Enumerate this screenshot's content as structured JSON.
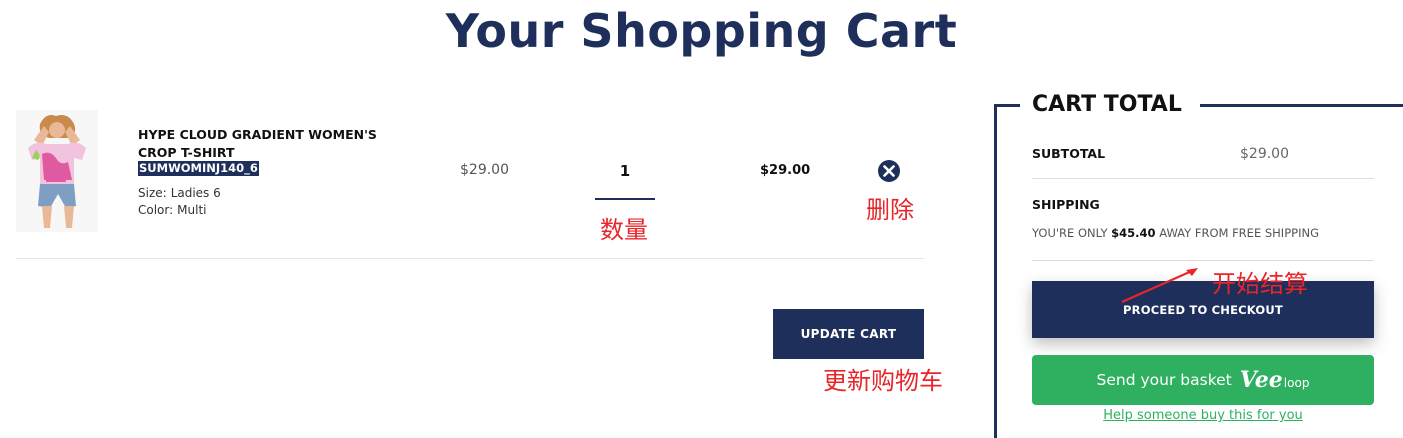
{
  "page": {
    "title": "Your Shopping Cart"
  },
  "item": {
    "name": "HYPE CLOUD GRADIENT WOMEN'S CROP T-SHIRT",
    "sku": "SUMWOMINJ140_6",
    "size_label": "Size:",
    "size_value": "Ladies 6",
    "color_label": "Color:",
    "color_value": "Multi",
    "unit_price": "$29.00",
    "quantity": "1",
    "line_total": "$29.00",
    "image_icon": "product-photo-tshirt",
    "remove_icon": "circle-x-icon"
  },
  "actions": {
    "update_cart": "UPDATE CART"
  },
  "annotations": {
    "quantity": "数量",
    "remove": "删除",
    "update_cart": "更新购物车",
    "checkout": "开始结算"
  },
  "cart_total": {
    "title": "CART TOTAL",
    "subtotal_label": "SUBTOTAL",
    "subtotal_value": "$29.00",
    "shipping_label": "SHIPPING",
    "shipping_prefix": "YOU'RE ONLY",
    "shipping_amount": "$45.40",
    "shipping_suffix": "AWAY FROM FREE SHIPPING",
    "checkout_label": "PROCEED TO CHECKOUT",
    "veeloop_label": "Send your basket",
    "veeloop_logo_vee": "Vee",
    "veeloop_logo_loop": "loop",
    "help_link": "Help someone buy this for you"
  },
  "colors": {
    "navy": "#1d2f5a",
    "green": "#2eb060",
    "annotation_red": "#e8262a"
  }
}
